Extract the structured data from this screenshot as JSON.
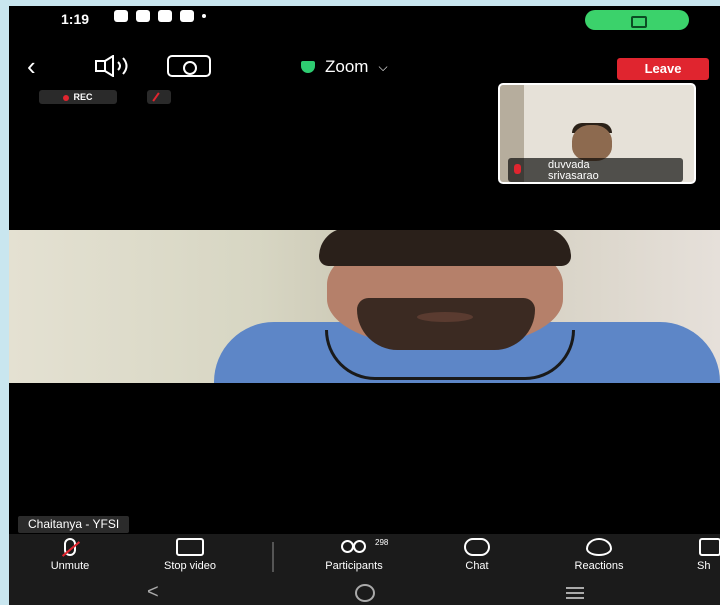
{
  "status_bar": {
    "time": "1:19"
  },
  "meeting": {
    "title": "Zoom",
    "leave_label": "Leave",
    "rec_label": "REC"
  },
  "thumbnail": {
    "participant_name": "duvvada\nsrivasarao"
  },
  "main_video": {
    "speaker_name": "Chaitanya - YFSI"
  },
  "toolbar": {
    "unmute_label": "Unmute",
    "stop_video_label": "Stop video",
    "participants_label": "Participants",
    "participants_count": "298",
    "chat_label": "Chat",
    "reactions_label": "Reactions",
    "share_label": "Sh"
  },
  "icons": {
    "back": "chevron-left-icon",
    "speaker": "speaker-icon",
    "camera_switch": "camera-switch-icon",
    "shield": "shield-icon",
    "mic_muted": "mic-muted-icon",
    "video": "video-camera-icon",
    "participants": "people-icon",
    "chat": "chat-icon",
    "reactions": "heart-icon",
    "share": "share-icon"
  },
  "colors": {
    "leave": "#e0252f",
    "call_pill": "#3bd26b",
    "shield": "#2ecc71",
    "background": "#000000"
  }
}
